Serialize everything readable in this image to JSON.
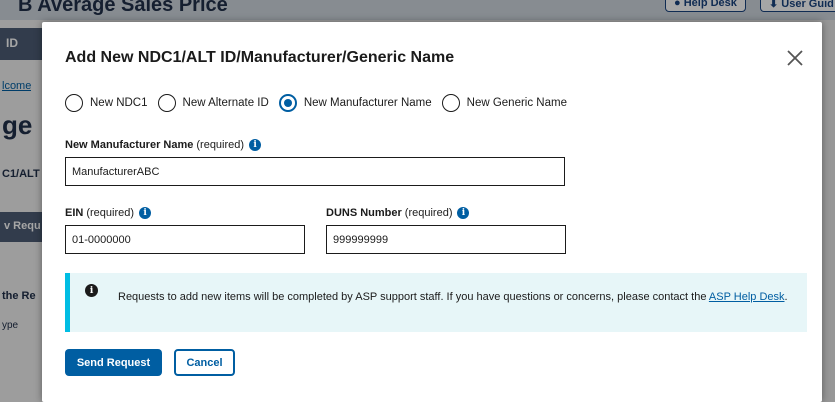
{
  "background": {
    "page_title": "B Average Sales Price",
    "help_desk_label": "Help Desk",
    "user_guide_label": "User Guid",
    "tab_label": "ID",
    "welcome_text": "lcome",
    "heading_fragment": "ge",
    "column_fragment": "C1/ALT",
    "request_button_fragment": "v Requ",
    "table_fragment": "the Re",
    "type_fragment": "ype"
  },
  "modal": {
    "title": "Add New NDC1/ALT ID/Manufacturer/Generic Name",
    "close_icon": "close-icon",
    "radio_options": [
      {
        "label": "New NDC1",
        "checked": false
      },
      {
        "label": "New Alternate ID",
        "checked": false
      },
      {
        "label": "New Manufacturer Name",
        "checked": true
      },
      {
        "label": "New Generic Name",
        "checked": false
      }
    ],
    "manufacturer_field": {
      "label": "New Manufacturer Name",
      "required_text": "(required)",
      "value": "ManufacturerABC"
    },
    "ein_field": {
      "label": "EIN",
      "required_text": "(required)",
      "value": "01-0000000"
    },
    "duns_field": {
      "label": "DUNS Number",
      "required_text": "(required)",
      "value": "999999999"
    },
    "alert": {
      "icon": "info-icon",
      "text": "Requests to add new items will be completed by ASP support staff. If you have questions or concerns, please contact the ",
      "link_text": "ASP Help Desk",
      "text_end": "."
    },
    "send_label": "Send Request",
    "cancel_label": "Cancel"
  },
  "colors": {
    "primary": "#005ea2",
    "alert_border": "#00bde3",
    "alert_bg": "#e7f6f8"
  }
}
